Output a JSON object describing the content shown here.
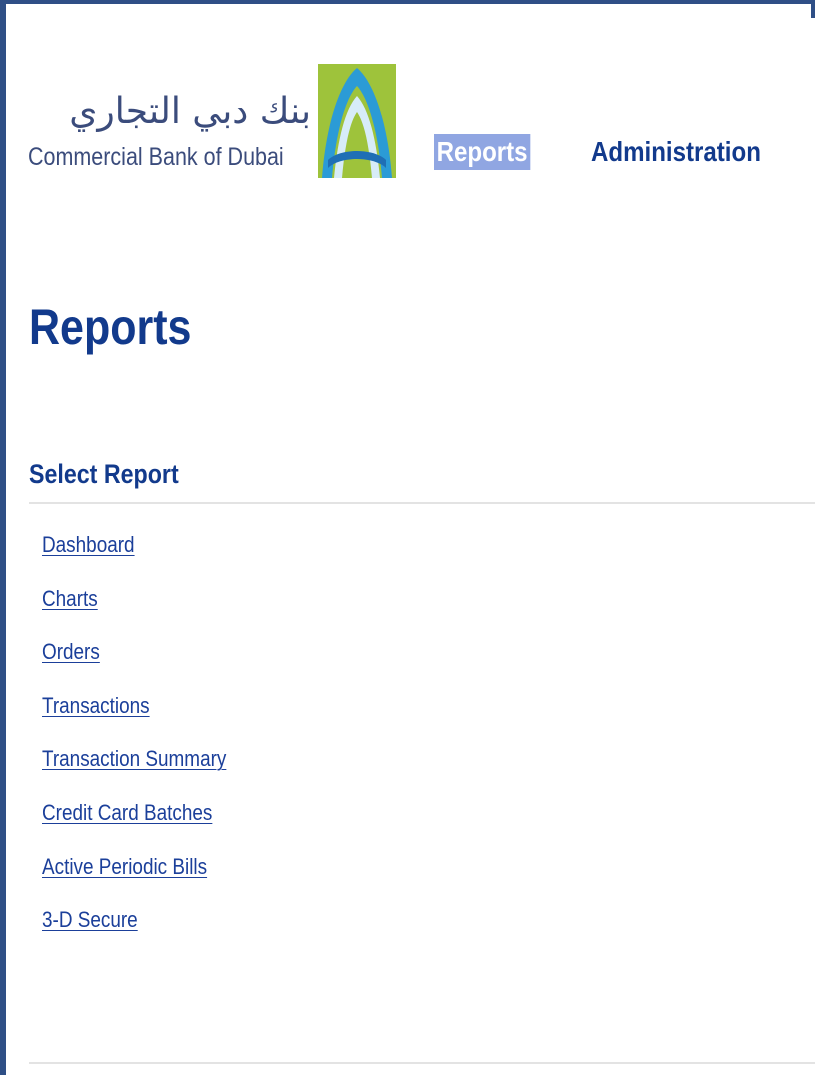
{
  "brand": {
    "name_arabic": "بنك دبي التجاري",
    "name_english": "Commercial Bank of Dubai",
    "logo_icon": "cbd-arch-logo"
  },
  "nav": {
    "items": [
      {
        "label": "Reports",
        "active": true
      },
      {
        "label": "Administration",
        "active": false
      }
    ]
  },
  "page": {
    "title": "Reports",
    "section_title": "Select Report"
  },
  "reports": [
    {
      "label": "Dashboard"
    },
    {
      "label": "Charts"
    },
    {
      "label": "Orders"
    },
    {
      "label": "Transactions"
    },
    {
      "label": "Transaction Summary"
    },
    {
      "label": "Credit Card Batches"
    },
    {
      "label": "Active Periodic Bills"
    },
    {
      "label": "3-D Secure"
    }
  ],
  "colors": {
    "primary": "#123a8c",
    "link": "#1b3f9a",
    "nav_active_bg": "#90a6e2",
    "frame": "#2f4f86",
    "logo_green": "#9ec33b",
    "logo_blue": "#2b9bd6"
  }
}
